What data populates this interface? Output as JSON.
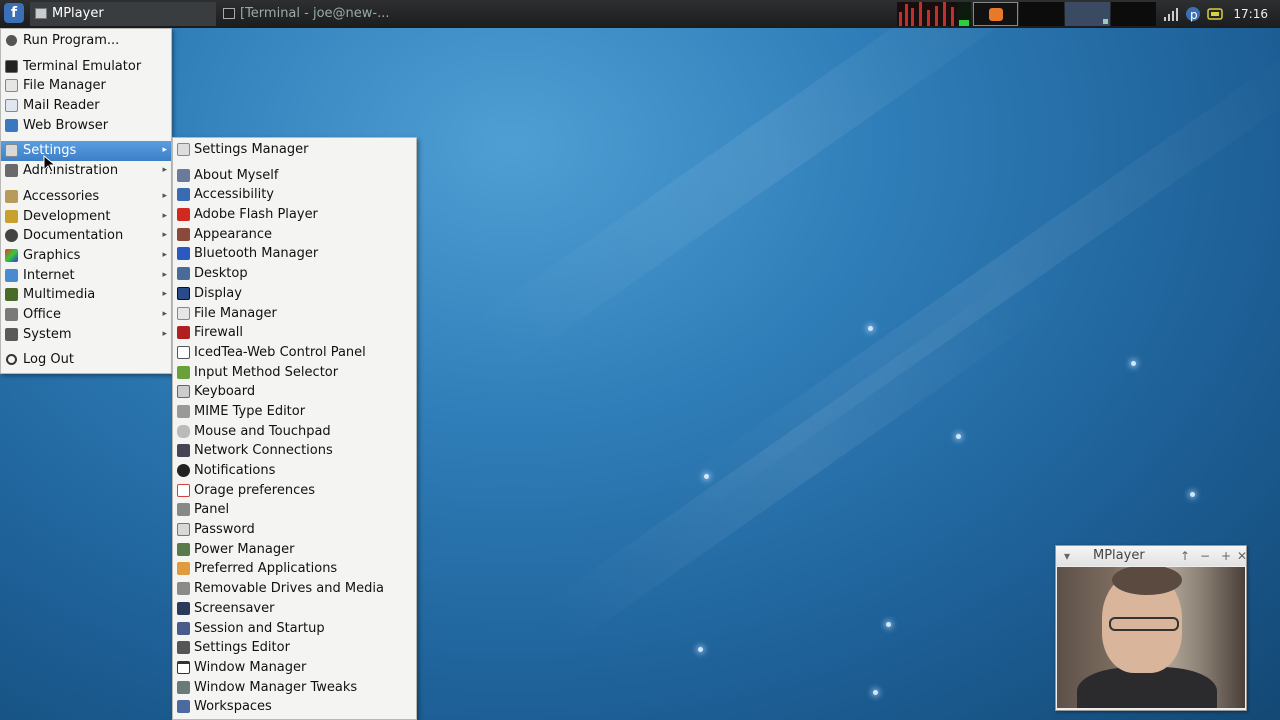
{
  "panel": {
    "app_menu_icon": "fedora-logo-icon",
    "tasks": [
      {
        "label": "MPlayer",
        "icon": "window-icon"
      },
      {
        "label": "[Terminal - joe@new-...",
        "icon": "terminal-icon"
      }
    ],
    "clock": "17:16",
    "tray_icons": [
      "signal-icon",
      "pulseaudio-icon",
      "power-icon",
      "battery-icon"
    ]
  },
  "main_menu": {
    "items": [
      {
        "label": "Run Program...",
        "icon": "gear-icon",
        "submenu": false
      },
      {
        "label": "Terminal Emulator",
        "icon": "terminal-icon",
        "submenu": false
      },
      {
        "label": "File Manager",
        "icon": "file-manager-icon",
        "submenu": false
      },
      {
        "label": "Mail Reader",
        "icon": "mail-icon",
        "submenu": false
      },
      {
        "label": "Web Browser",
        "icon": "web-browser-icon",
        "submenu": false
      },
      {
        "label": "Settings",
        "icon": "settings-icon",
        "submenu": true,
        "highlighted": true
      },
      {
        "label": "Administration",
        "icon": "administration-icon",
        "submenu": true
      },
      {
        "label": "Accessories",
        "icon": "accessories-icon",
        "submenu": true
      },
      {
        "label": "Development",
        "icon": "development-icon",
        "submenu": true
      },
      {
        "label": "Documentation",
        "icon": "documentation-icon",
        "submenu": true
      },
      {
        "label": "Graphics",
        "icon": "graphics-icon",
        "submenu": true
      },
      {
        "label": "Internet",
        "icon": "internet-icon",
        "submenu": true
      },
      {
        "label": "Multimedia",
        "icon": "multimedia-icon",
        "submenu": true
      },
      {
        "label": "Office",
        "icon": "office-icon",
        "submenu": true
      },
      {
        "label": "System",
        "icon": "system-icon",
        "submenu": true
      },
      {
        "label": "Log Out",
        "icon": "log-out-icon",
        "submenu": false
      }
    ]
  },
  "settings_menu": {
    "items": [
      {
        "label": "Settings Manager",
        "icon": "settings-manager-icon"
      },
      {
        "label": "About Myself",
        "icon": "about-myself-icon"
      },
      {
        "label": "Accessibility",
        "icon": "accessibility-icon"
      },
      {
        "label": "Adobe Flash Player",
        "icon": "flash-player-icon"
      },
      {
        "label": "Appearance",
        "icon": "appearance-icon"
      },
      {
        "label": "Bluetooth Manager",
        "icon": "bluetooth-icon"
      },
      {
        "label": "Desktop",
        "icon": "desktop-icon"
      },
      {
        "label": "Display",
        "icon": "display-icon"
      },
      {
        "label": "File Manager",
        "icon": "file-manager-icon"
      },
      {
        "label": "Firewall",
        "icon": "firewall-icon"
      },
      {
        "label": "IcedTea-Web Control Panel",
        "icon": "java-icon"
      },
      {
        "label": "Input Method Selector",
        "icon": "input-method-icon"
      },
      {
        "label": "Keyboard",
        "icon": "keyboard-icon"
      },
      {
        "label": "MIME Type Editor",
        "icon": "mime-type-icon"
      },
      {
        "label": "Mouse and Touchpad",
        "icon": "mouse-icon"
      },
      {
        "label": "Network Connections",
        "icon": "network-icon"
      },
      {
        "label": "Notifications",
        "icon": "notifications-icon"
      },
      {
        "label": "Orage preferences",
        "icon": "calendar-icon"
      },
      {
        "label": "Panel",
        "icon": "panel-icon"
      },
      {
        "label": "Password",
        "icon": "password-icon"
      },
      {
        "label": "Power Manager",
        "icon": "power-manager-icon"
      },
      {
        "label": "Preferred Applications",
        "icon": "preferred-apps-icon"
      },
      {
        "label": "Removable Drives and Media",
        "icon": "removable-drives-icon"
      },
      {
        "label": "Screensaver",
        "icon": "screensaver-icon"
      },
      {
        "label": "Session and Startup",
        "icon": "session-icon"
      },
      {
        "label": "Settings Editor",
        "icon": "settings-editor-icon"
      },
      {
        "label": "Window Manager",
        "icon": "window-manager-icon"
      },
      {
        "label": "Window Manager Tweaks",
        "icon": "wm-tweaks-icon"
      },
      {
        "label": "Workspaces",
        "icon": "workspaces-icon"
      }
    ]
  },
  "mplayer_window": {
    "title": "MPlayer",
    "buttons": [
      "menu-icon",
      "raise-icon",
      "minimize-icon",
      "maximize-icon",
      "close-icon"
    ]
  }
}
